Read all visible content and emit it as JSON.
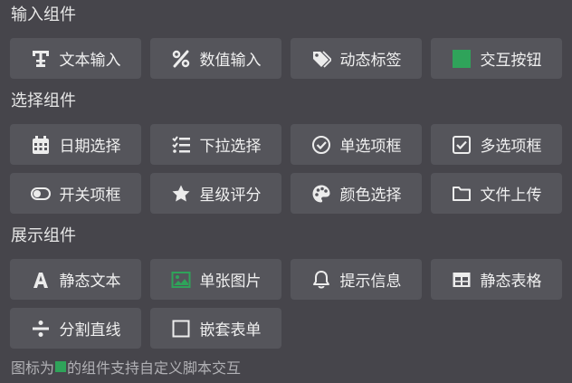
{
  "sections": [
    {
      "title": "输入组件"
    },
    {
      "title": "选择组件"
    },
    {
      "title": "展示组件"
    }
  ],
  "input_items": [
    {
      "label": "文本输入",
      "icon": "text-icon"
    },
    {
      "label": "数值输入",
      "icon": "percent-icon"
    },
    {
      "label": "动态标签",
      "icon": "tags-icon"
    },
    {
      "label": "交互按钮",
      "icon": "green-square-icon"
    }
  ],
  "select_items": [
    {
      "label": "日期选择",
      "icon": "calendar-icon"
    },
    {
      "label": "下拉选择",
      "icon": "checklist-icon"
    },
    {
      "label": "单选项框",
      "icon": "check-circle-icon"
    },
    {
      "label": "多选项框",
      "icon": "checkbox-icon"
    },
    {
      "label": "开关项框",
      "icon": "toggle-icon"
    },
    {
      "label": "星级评分",
      "icon": "star-icon"
    },
    {
      "label": "颜色选择",
      "icon": "palette-icon"
    },
    {
      "label": "文件上传",
      "icon": "folder-icon"
    }
  ],
  "display_items": [
    {
      "label": "静态文本",
      "icon": "font-a-icon"
    },
    {
      "label": "单张图片",
      "icon": "image-icon"
    },
    {
      "label": "提示信息",
      "icon": "bell-icon"
    },
    {
      "label": "静态表格",
      "icon": "table-icon"
    },
    {
      "label": "分割直线",
      "icon": "divide-icon"
    },
    {
      "label": "嵌套表单",
      "icon": "square-icon"
    }
  ],
  "footer": {
    "prefix": "图标为",
    "suffix": "的组件支持自定义脚本交互"
  },
  "colors": {
    "background": "#46454b",
    "button": "#55555b",
    "accent_green": "#2fa35a"
  }
}
